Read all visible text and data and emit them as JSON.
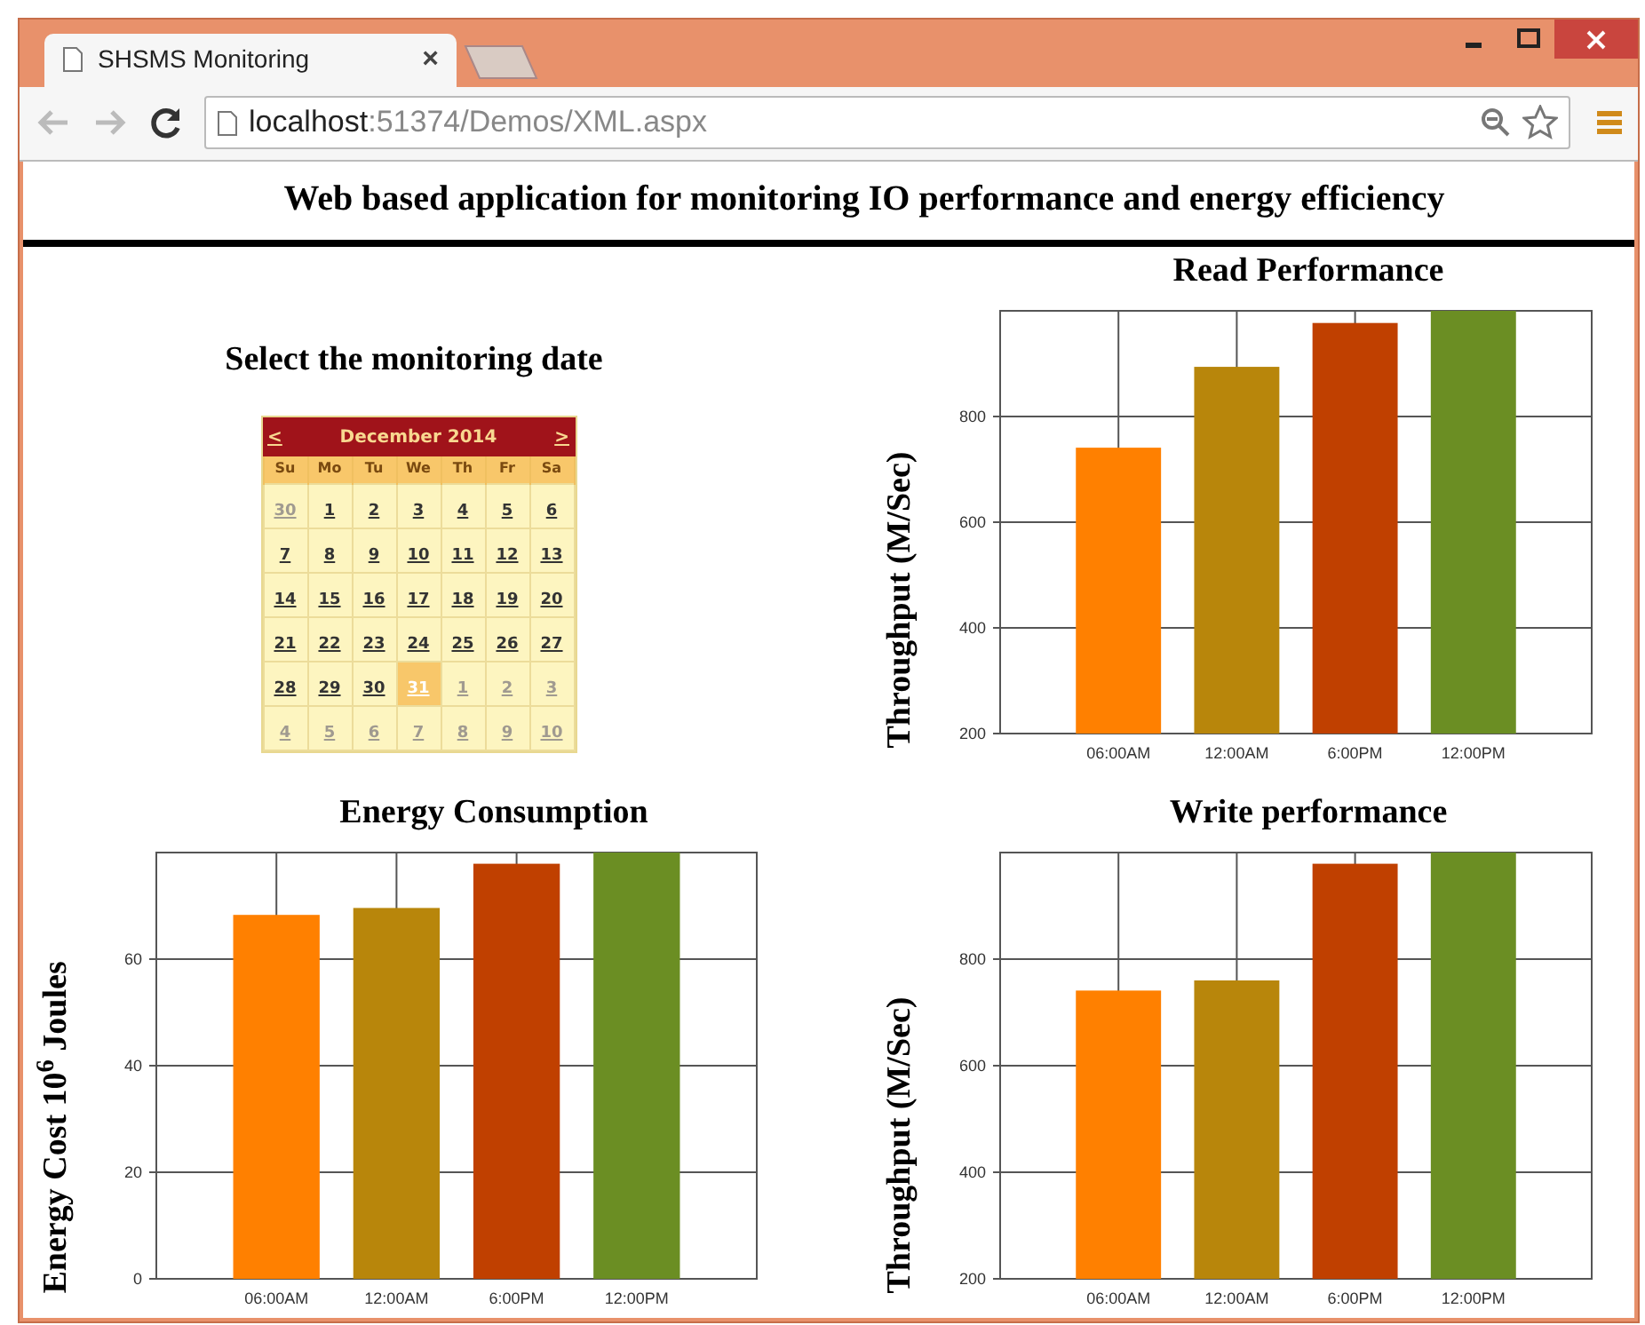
{
  "browser": {
    "tab_title": "SHSMS Monitoring",
    "tab_close": "×",
    "url_host": "localhost",
    "url_path": ":51374/Demos/XML.aspx"
  },
  "page": {
    "heading": "Web based application for monitoring IO performance and energy efficiency"
  },
  "date_picker": {
    "title": "Select the monitoring date",
    "prev": "<",
    "next": ">",
    "month": "December 2014",
    "weekdays": [
      "Su",
      "Mo",
      "Tu",
      "We",
      "Th",
      "Fr",
      "Sa"
    ],
    "weeks": [
      [
        {
          "day": "30",
          "other_month": true,
          "selected": false
        },
        {
          "day": "1",
          "other_month": false,
          "selected": false
        },
        {
          "day": "2",
          "other_month": false,
          "selected": false
        },
        {
          "day": "3",
          "other_month": false,
          "selected": false
        },
        {
          "day": "4",
          "other_month": false,
          "selected": false
        },
        {
          "day": "5",
          "other_month": false,
          "selected": false
        },
        {
          "day": "6",
          "other_month": false,
          "selected": false
        }
      ],
      [
        {
          "day": "7",
          "other_month": false,
          "selected": false
        },
        {
          "day": "8",
          "other_month": false,
          "selected": false
        },
        {
          "day": "9",
          "other_month": false,
          "selected": false
        },
        {
          "day": "10",
          "other_month": false,
          "selected": false
        },
        {
          "day": "11",
          "other_month": false,
          "selected": false
        },
        {
          "day": "12",
          "other_month": false,
          "selected": false
        },
        {
          "day": "13",
          "other_month": false,
          "selected": false
        }
      ],
      [
        {
          "day": "14",
          "other_month": false,
          "selected": false
        },
        {
          "day": "15",
          "other_month": false,
          "selected": false
        },
        {
          "day": "16",
          "other_month": false,
          "selected": false
        },
        {
          "day": "17",
          "other_month": false,
          "selected": false
        },
        {
          "day": "18",
          "other_month": false,
          "selected": false
        },
        {
          "day": "19",
          "other_month": false,
          "selected": false
        },
        {
          "day": "20",
          "other_month": false,
          "selected": false
        }
      ],
      [
        {
          "day": "21",
          "other_month": false,
          "selected": false
        },
        {
          "day": "22",
          "other_month": false,
          "selected": false
        },
        {
          "day": "23",
          "other_month": false,
          "selected": false
        },
        {
          "day": "24",
          "other_month": false,
          "selected": false
        },
        {
          "day": "25",
          "other_month": false,
          "selected": false
        },
        {
          "day": "26",
          "other_month": false,
          "selected": false
        },
        {
          "day": "27",
          "other_month": false,
          "selected": false
        }
      ],
      [
        {
          "day": "28",
          "other_month": false,
          "selected": false
        },
        {
          "day": "29",
          "other_month": false,
          "selected": false
        },
        {
          "day": "30",
          "other_month": false,
          "selected": false
        },
        {
          "day": "31",
          "other_month": false,
          "selected": true
        },
        {
          "day": "1",
          "other_month": true,
          "selected": false
        },
        {
          "day": "2",
          "other_month": true,
          "selected": false
        },
        {
          "day": "3",
          "other_month": true,
          "selected": false
        }
      ],
      [
        {
          "day": "4",
          "other_month": true,
          "selected": false
        },
        {
          "day": "5",
          "other_month": true,
          "selected": false
        },
        {
          "day": "6",
          "other_month": true,
          "selected": false
        },
        {
          "day": "7",
          "other_month": true,
          "selected": false
        },
        {
          "day": "8",
          "other_month": true,
          "selected": false
        },
        {
          "day": "9",
          "other_month": true,
          "selected": false
        },
        {
          "day": "10",
          "other_month": true,
          "selected": false
        }
      ]
    ]
  },
  "read_chart": {
    "chart_data": {
      "type": "bar",
      "title": "Read Performance",
      "ylabel": "Throughput (M/Sec)",
      "categories": [
        "06:00AM",
        "12:00AM",
        "6:00PM",
        "12:00PM"
      ],
      "series": [
        {
          "colors": [
            "#ff8000",
            "#b8860b",
            "#c04000",
            "#6b8e23"
          ],
          "values": [
            741,
            894,
            977,
            1000
          ]
        }
      ],
      "ylim": [
        200,
        1000
      ],
      "yticks": [
        200,
        400,
        600,
        800
      ],
      "grid": true
    }
  },
  "energy_chart": {
    "chart_data": {
      "type": "bar",
      "title": "Energy Consumption",
      "ylabel": "Energy Cost  10$^{6}$ Joules",
      "categories": [
        "06:00AM",
        "12:00AM",
        "6:00PM",
        "12:00PM"
      ],
      "series": [
        {
          "colors": [
            "#ff8000",
            "#b8860b",
            "#c04000",
            "#6b8e23"
          ],
          "values": [
            68.3,
            69.6,
            77.9,
            80
          ]
        }
      ],
      "ylim": [
        0,
        80
      ],
      "yticks": [
        0,
        20,
        40,
        60
      ],
      "grid": true
    }
  },
  "write_chart": {
    "chart_data": {
      "type": "bar",
      "title": "Write performance",
      "ylabel": "Throughput (M/Sec)",
      "categories": [
        "06:00AM",
        "12:00AM",
        "6:00PM",
        "12:00PM"
      ],
      "series": [
        {
          "colors": [
            "#ff8000",
            "#b8860b",
            "#c04000",
            "#6b8e23"
          ],
          "values": [
            741,
            760,
            979,
            1000
          ]
        }
      ],
      "ylim": [
        200,
        1000
      ],
      "yticks": [
        200,
        400,
        600,
        800
      ],
      "grid": true
    }
  }
}
